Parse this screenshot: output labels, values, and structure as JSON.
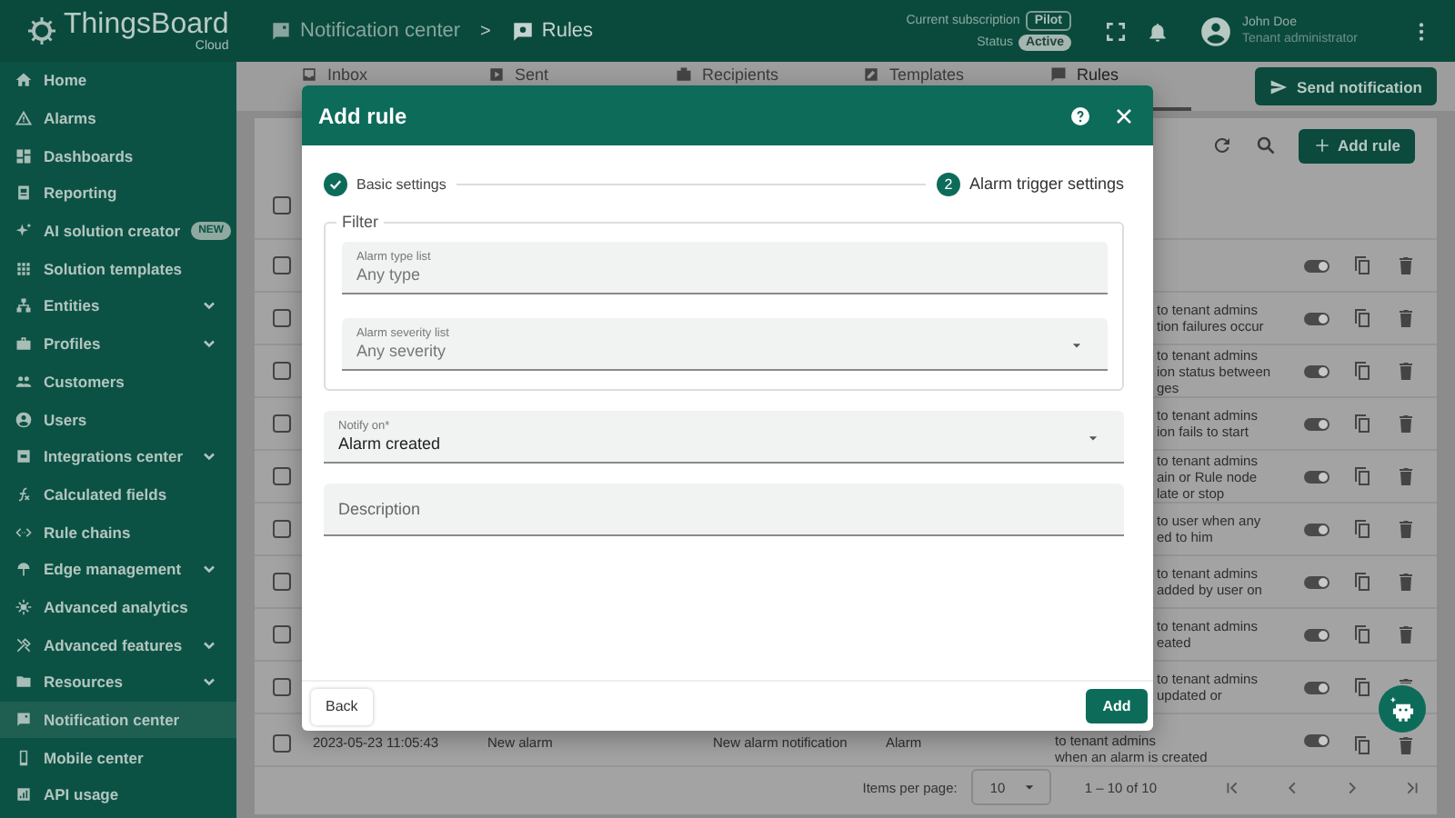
{
  "header": {
    "logo": {
      "title": "ThingsBoard",
      "subtitle": "Cloud"
    },
    "breadcrumb": [
      {
        "label": "Notification center"
      },
      {
        "label": "Rules"
      }
    ],
    "separator": ">",
    "subscription": {
      "label": "Current subscription",
      "value": "Pilot"
    },
    "status": {
      "label": "Status",
      "value": "Active"
    },
    "user": {
      "name": "John Doe",
      "role": "Tenant administrator"
    }
  },
  "sidebar": {
    "items": [
      {
        "label": "Home",
        "kind": "link",
        "selected": false
      },
      {
        "label": "Alarms",
        "kind": "link",
        "selected": false
      },
      {
        "label": "Dashboards",
        "kind": "link",
        "selected": false
      },
      {
        "label": "Reporting",
        "kind": "link",
        "selected": false
      },
      {
        "label": "AI solution creator",
        "kind": "link",
        "selected": false,
        "badge": "NEW"
      },
      {
        "label": "Solution templates",
        "kind": "link",
        "selected": false
      },
      {
        "label": "Entities",
        "kind": "group",
        "expanded": false,
        "selected": false
      },
      {
        "label": "Profiles",
        "kind": "group",
        "expanded": false,
        "selected": false
      },
      {
        "label": "Customers",
        "kind": "link",
        "selected": false
      },
      {
        "label": "Users",
        "kind": "link",
        "selected": false
      },
      {
        "label": "Integrations center",
        "kind": "group",
        "expanded": false,
        "selected": false
      },
      {
        "label": "Calculated fields",
        "kind": "link",
        "selected": false
      },
      {
        "label": "Rule chains",
        "kind": "link",
        "selected": false
      },
      {
        "label": "Edge management",
        "kind": "group",
        "expanded": false,
        "selected": false
      },
      {
        "label": "Advanced analytics",
        "kind": "link",
        "selected": false
      },
      {
        "label": "Advanced features",
        "kind": "group",
        "expanded": false,
        "selected": false
      },
      {
        "label": "Resources",
        "kind": "group",
        "expanded": false,
        "selected": false
      },
      {
        "label": "Notification center",
        "kind": "link",
        "selected": true
      },
      {
        "label": "Mobile center",
        "kind": "link",
        "selected": false
      },
      {
        "label": "API usage",
        "kind": "link",
        "selected": false
      }
    ]
  },
  "tabs": [
    {
      "label": "Inbox",
      "selected": false
    },
    {
      "label": "Sent",
      "selected": false
    },
    {
      "label": "Recipients",
      "selected": false
    },
    {
      "label": "Templates",
      "selected": false
    },
    {
      "label": "Rules",
      "selected": true
    }
  ],
  "send_button": "Send notification",
  "table": {
    "add_button": "Add rule",
    "all_checked": false,
    "rows": [
      {
        "checked": false,
        "description": [],
        "enabled": true
      },
      {
        "checked": false,
        "description": [
          "to tenant admins",
          "tion failures occur"
        ],
        "enabled": true
      },
      {
        "checked": false,
        "description": [
          "to tenant admins",
          "ion status between",
          "ges"
        ],
        "enabled": true
      },
      {
        "checked": false,
        "description": [
          "to tenant admins",
          "ion fails to start"
        ],
        "enabled": true
      },
      {
        "checked": false,
        "description": [
          "to tenant admins",
          "ain or Rule node",
          "late or stop"
        ],
        "enabled": true
      },
      {
        "checked": false,
        "description": [
          "to user when any",
          "ed to him"
        ],
        "enabled": true
      },
      {
        "checked": false,
        "description": [
          "to tenant admins",
          "added by user on"
        ],
        "enabled": true
      },
      {
        "checked": false,
        "description": [
          "to tenant admins",
          "eated"
        ],
        "enabled": true
      },
      {
        "checked": false,
        "description": [
          "to tenant admins",
          "updated or"
        ],
        "enabled": true
      },
      {
        "checked": false,
        "created": "2023-05-23 11:05:43",
        "name": "New alarm",
        "template": "New alarm notification",
        "trigger": "Alarm",
        "description": [
          "to tenant admins",
          "when an alarm is created"
        ],
        "enabled": true
      }
    ],
    "paginator": {
      "label": "Items per page:",
      "page_size": "10",
      "range": "1 – 10 of 10"
    }
  },
  "dialog": {
    "title": "Add rule",
    "steps": [
      {
        "label": "Basic settings",
        "done": true
      },
      {
        "label": "Alarm trigger settings",
        "number": "2",
        "done": false
      }
    ],
    "filter": {
      "legend": "Filter",
      "fields": [
        {
          "kind": "text",
          "label": "Alarm type list",
          "placeholder": "Any type"
        },
        {
          "kind": "select",
          "label": "Alarm severity list",
          "placeholder": "Any severity"
        }
      ]
    },
    "fields": [
      {
        "kind": "select",
        "label": "Notify on*",
        "value": "Alarm created"
      },
      {
        "kind": "text",
        "placeholder": "Description"
      }
    ],
    "back_button": "Back",
    "submit_button": "Add"
  }
}
